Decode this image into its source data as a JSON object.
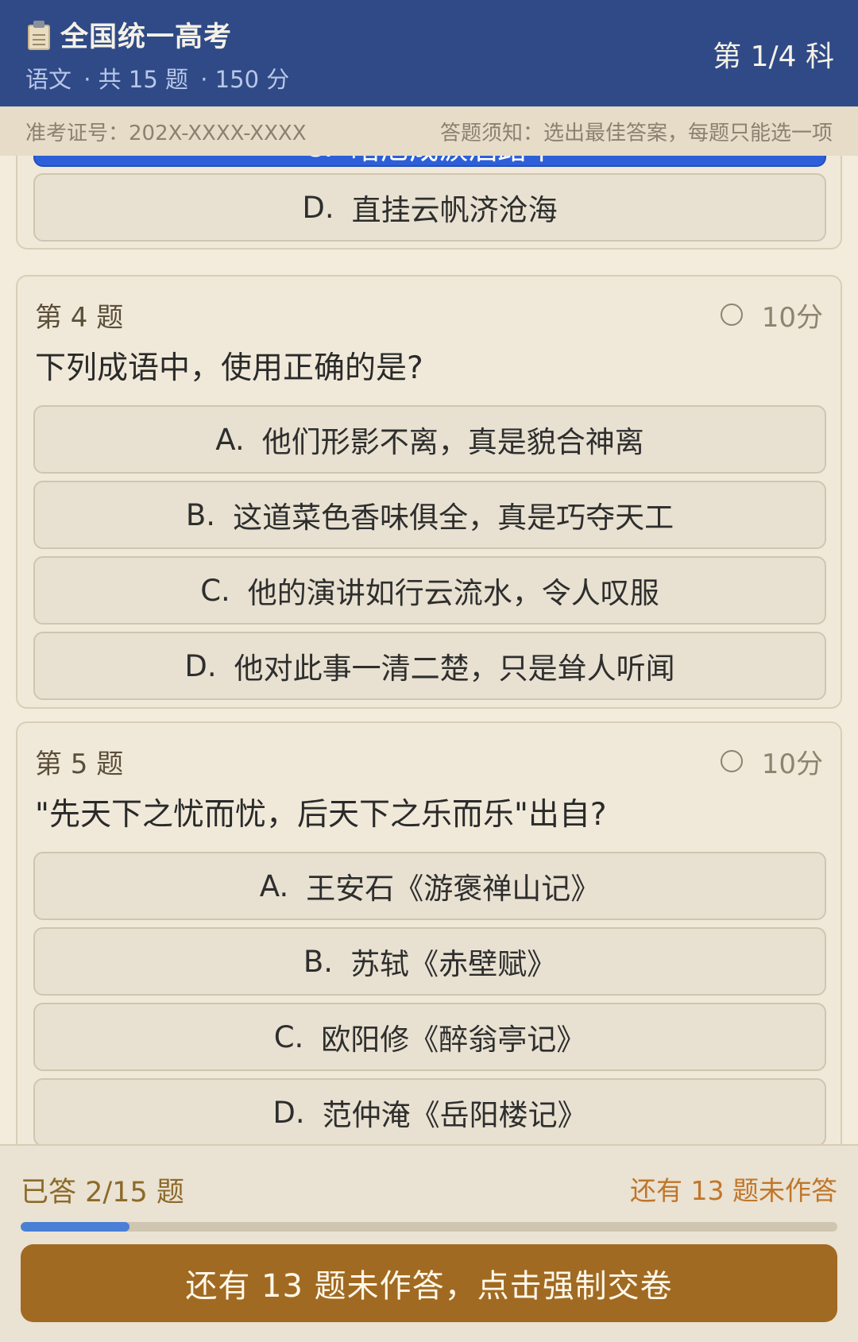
{
  "header": {
    "title": "全国统一高考",
    "subject": "语文",
    "count_text": "· 共 15 题",
    "score_text": "· 150 分",
    "progress": "第 1/4 科"
  },
  "infobar": {
    "exam_id": "准考证号：202X-XXXX-XXXX",
    "notice": "答题须知：选出最佳答案，每题只能选一项"
  },
  "prev_question": {
    "options": [
      {
        "letter": "C.",
        "text": "暗尼成淚酒路中",
        "selected": true
      },
      {
        "letter": "D.",
        "text": "直挂云帆济沧海",
        "selected": false
      }
    ]
  },
  "questions": [
    {
      "number": "第 4 题",
      "score": "10分",
      "text": "下列成语中，使用正确的是?",
      "options": [
        {
          "letter": "A.",
          "text": "他们形影不离，真是貌合神离"
        },
        {
          "letter": "B.",
          "text": "这道菜色香味俱全，真是巧夺天工"
        },
        {
          "letter": "C.",
          "text": "他的演讲如行云流水，令人叹服"
        },
        {
          "letter": "D.",
          "text": "他对此事一清二楚，只是耸人听闻"
        }
      ]
    },
    {
      "number": "第 5 题",
      "score": "10分",
      "text": "\"先天下之忧而忧，后天下之乐而乐\"出自?",
      "options": [
        {
          "letter": "A.",
          "text": "王安石《游褒禅山记》"
        },
        {
          "letter": "B.",
          "text": "苏轼《赤壁赋》"
        },
        {
          "letter": "C.",
          "text": "欧阳修《醉翁亭记》"
        },
        {
          "letter": "D.",
          "text": "范仲淹《岳阳楼记》"
        }
      ]
    }
  ],
  "footer": {
    "answered": "已答 2/15 题",
    "remaining": "还有 13 题未作答",
    "progress_fraction": 0.133,
    "submit_label": "还有 13 题未作答，点击强制交卷"
  },
  "colors": {
    "header_bg": "#2f4a86",
    "selected": "#2d5fd8",
    "submit": "#a16a22",
    "progress": "#4a7fd6"
  }
}
